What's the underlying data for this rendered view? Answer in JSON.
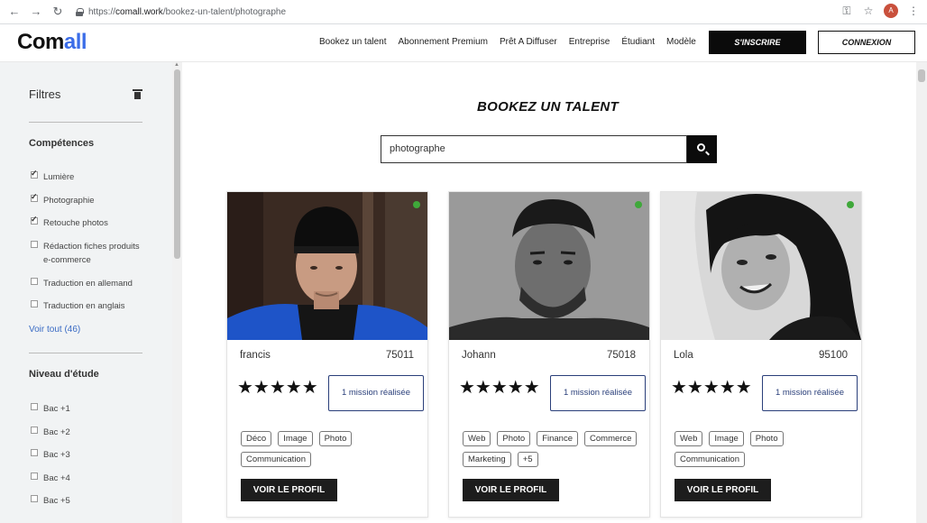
{
  "browser": {
    "url_prefix": "https://",
    "url_host": "comall.work",
    "url_path": "/bookez-un-talent/photographe",
    "avatar_letter": "A"
  },
  "header": {
    "logo_main": "Com",
    "logo_accent": "all",
    "logo_accent_color": "#3b6de8",
    "nav": [
      "Bookez un talent",
      "Abonnement Premium",
      "Prêt A Diffuser",
      "Entreprise",
      "Étudiant",
      "Modèle"
    ],
    "signup_label": "S'INSCRIRE",
    "login_label": "CONNEXION"
  },
  "sidebar": {
    "title": "Filtres",
    "competences_title": "Compétences",
    "competences": [
      {
        "label": "Lumière",
        "checked": true
      },
      {
        "label": "Photographie",
        "checked": true
      },
      {
        "label": "Retouche photos",
        "checked": true
      },
      {
        "label": "Rédaction fiches produits e-commerce",
        "checked": false
      },
      {
        "label": "Traduction en allemand",
        "checked": false
      },
      {
        "label": "Traduction en anglais",
        "checked": false
      }
    ],
    "see_all": "Voir tout (46)",
    "niveau_title": "Niveau d'étude",
    "niveaux": [
      {
        "label": "Bac +1",
        "checked": false
      },
      {
        "label": "Bac +2",
        "checked": false
      },
      {
        "label": "Bac +3",
        "checked": false
      },
      {
        "label": "Bac +4",
        "checked": false
      },
      {
        "label": "Bac +5",
        "checked": false
      }
    ]
  },
  "main": {
    "title": "BOOKEZ UN TALENT",
    "search_value": "photographe",
    "cards": [
      {
        "name": "francis",
        "zip": "75011",
        "stars": "★★★★★",
        "rating": 5,
        "missions": "1 mission réalisée",
        "online": true,
        "tags": [
          "Déco",
          "Image",
          "Photo",
          "Communication"
        ],
        "button": "VOIR LE PROFIL"
      },
      {
        "name": "Johann",
        "zip": "75018",
        "stars": "★★★★★",
        "rating": 5,
        "missions": "1 mission réalisée",
        "online": true,
        "tags": [
          "Web",
          "Photo",
          "Finance",
          "Commerce",
          "Marketing",
          "+5"
        ],
        "button": "VOIR LE PROFIL"
      },
      {
        "name": "Lola",
        "zip": "95100",
        "stars": "★★★★★",
        "rating": 5,
        "missions": "1 mission réalisée",
        "online": true,
        "tags": [
          "Web",
          "Image",
          "Photo",
          "Communication"
        ],
        "button": "VOIR LE PROFIL"
      }
    ]
  }
}
